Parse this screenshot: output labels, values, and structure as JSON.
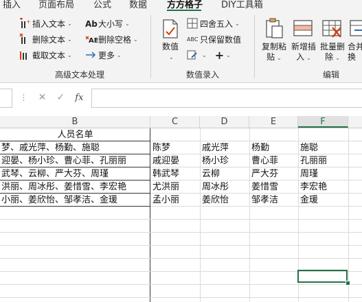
{
  "tabs": [
    "插入",
    "页面布局",
    "公式",
    "数据",
    "方方格子",
    "DIY工具箱"
  ],
  "groups": {
    "text": {
      "label": "高级文本处理",
      "insert_text": "插入文本",
      "delete_text": "删除文本",
      "extract_text": "截取文本",
      "case": "大小写",
      "delete_space": "删除空格",
      "more": "更多"
    },
    "numeric": {
      "label": "数值录入",
      "value": "数值",
      "round": "四舍五入",
      "keep_value": "只保留数值"
    },
    "edit": {
      "label": "编辑",
      "copy_paste": [
        "复制粘",
        "贴"
      ],
      "insert_new": [
        "新增插",
        "入"
      ],
      "batch_delete": [
        "批量删",
        "除"
      ],
      "merge_convert": [
        "合并",
        "换"
      ]
    }
  },
  "formula_bar": {
    "cancel": "✕",
    "enter": "✓",
    "fx": "fx",
    "value": ""
  },
  "columns": [
    "B",
    "C",
    "D",
    "E",
    "F"
  ],
  "selected_column": "F",
  "sheet": {
    "b_header": "人员名单",
    "b_rows": [
      "梦、戚光萍、杨勤、施聪",
      "迎晏、杨小珍、曹心菲、孔丽丽",
      "武琴、云柳、严大芬、周瑾",
      "洪丽、周冰彤、姜惜雪、李宏艳",
      "小丽、姜欣怡、邹孝洁、金瑗"
    ],
    "grid": [
      [
        "陈梦",
        "戚光萍",
        "杨勤",
        "施聪"
      ],
      [
        "戚迎晏",
        "杨小珍",
        "曹心菲",
        "孔丽丽"
      ],
      [
        "韩武琴",
        "云柳",
        "严大芬",
        "周瑾"
      ],
      [
        "尤洪丽",
        "周冰彤",
        "姜惜雪",
        "李宏艳"
      ],
      [
        "孟小丽",
        "姜欣怡",
        "邹孝洁",
        "金瑗"
      ]
    ]
  },
  "colors": {
    "accent": "#217346",
    "ribbon_bg": "#f3f3f3",
    "gridline": "#dadada"
  }
}
